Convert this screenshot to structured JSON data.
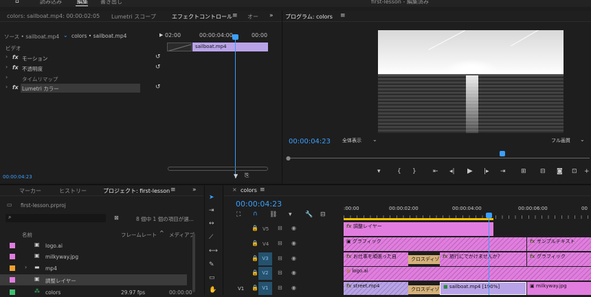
{
  "app": {
    "title": "first-lesson - 編集済み",
    "workspace_tabs": [
      "読み込み",
      "編集",
      "書き出し"
    ]
  },
  "effect_controls": {
    "tabs": [
      {
        "label": "colors: sailboat.mp4: 00:00:02:05"
      },
      {
        "label": "Lumetri スコープ"
      },
      {
        "label": "エフェクトコントロール"
      },
      {
        "label": "オー"
      }
    ],
    "source_label": "ソース • sailboat.mp4",
    "sequence_label": "colors • sailboat.mp4",
    "section": "ビデオ",
    "effects": [
      {
        "label": "モーション"
      },
      {
        "label": "不透明度"
      },
      {
        "label": "タイムリマップ"
      },
      {
        "label": "Lumetri カラー"
      }
    ],
    "ruler": [
      "02:00",
      "00:00:04:00",
      "00:00"
    ],
    "clip_name": "sailboat.mp4",
    "timecode": "00:00:04:23"
  },
  "program": {
    "tab": "プログラム: colors",
    "timecode": "00:00:04:23",
    "view": "全体表示",
    "quality": "フル画質"
  },
  "project": {
    "tabs": [
      {
        "label": "マーカー"
      },
      {
        "label": "ヒストリー"
      },
      {
        "label": "プロジェクト: first-lesson"
      }
    ],
    "file": "first-lesson.prproj",
    "search_placeholder": "",
    "status": "8 個中 1 個の項目が選...",
    "headers": {
      "name": "名前",
      "framerate": "フレームレート",
      "media": "メディアブ"
    },
    "items": [
      {
        "name": "logo.ai",
        "color": "#e17ddf",
        "framerate": ""
      },
      {
        "name": "milkyway.jpg",
        "color": "#e17ddf",
        "framerate": ""
      },
      {
        "name": "mp4",
        "color": "#f0a030",
        "framerate": ""
      },
      {
        "name": "調整レイヤー",
        "color": "#e17ddf",
        "framerate": ""
      },
      {
        "name": "colors",
        "color": "#3fbf6f",
        "framerate": "29.97 fps",
        "media": "00:00:00"
      }
    ]
  },
  "timeline": {
    "tab": "colors",
    "timecode": "00:00:04:23",
    "ruler": [
      ":00:00",
      "00:00:02:00",
      "00:00:04:00",
      "00:00:06:00",
      "00"
    ],
    "tracks": [
      {
        "label": "V5",
        "target": ""
      },
      {
        "label": "V4",
        "target": ""
      },
      {
        "label": "V3",
        "target": ""
      },
      {
        "label": "V2",
        "target": ""
      },
      {
        "label": "V1",
        "target": "V1"
      }
    ],
    "clips": {
      "c1": "調整レイヤー",
      "c2": "グラフィック",
      "c3": "サンプルテキスト",
      "c4": "お仕事を頑張った自",
      "c5": "クロスディゾ",
      "c6": "旅行にでかけませんか？",
      "c7": "グラフィック",
      "c8": "logo.ai",
      "c9": "street.mp4",
      "c10": "クロスディゾ",
      "c11": "sailboat.mp4 [190%]",
      "c12": "milkyway.jpg"
    }
  },
  "colors": {
    "accent": "#3aa0ff",
    "clip_pink": "#e17ddf",
    "clip_lavender": "#b9a3e8"
  }
}
